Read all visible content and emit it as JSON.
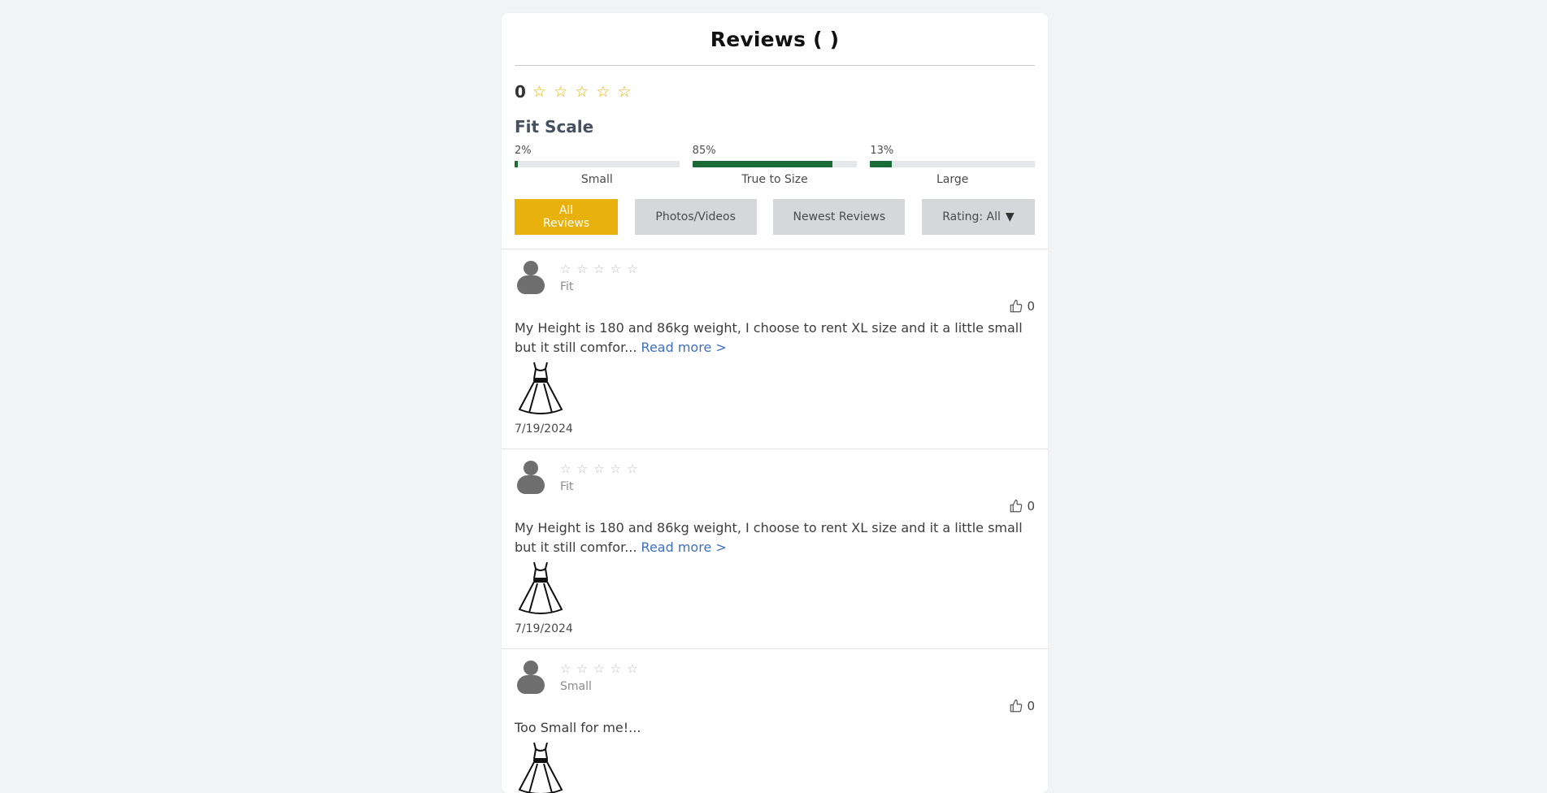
{
  "header": {
    "title": "Reviews ( )"
  },
  "summary": {
    "score": "0",
    "stars": [
      "☆",
      "☆",
      "☆",
      "☆",
      "☆"
    ]
  },
  "fit": {
    "title": "Fit Scale",
    "items": [
      {
        "pct_label": "2%",
        "value": 0.02,
        "label": "Small"
      },
      {
        "pct_label": "85%",
        "value": 0.85,
        "label": "True to Size"
      },
      {
        "pct_label": "13%",
        "value": 0.13,
        "label": "Large"
      }
    ]
  },
  "filters": {
    "all": "All Reviews",
    "photos": "Photos/Videos",
    "newest": "Newest Reviews",
    "rating": "Rating: All",
    "rating_caret": "▼"
  },
  "reviews": [
    {
      "stars": [
        "☆",
        "☆",
        "☆",
        "☆",
        "☆"
      ],
      "fit": "Fit",
      "likes": "0",
      "text": "My Height is 180 and 86kg weight, I choose to rent XL size and it a little small but it still comfor...",
      "read_more": "Read more >",
      "date": "7/19/2024"
    },
    {
      "stars": [
        "☆",
        "☆",
        "☆",
        "☆",
        "☆"
      ],
      "fit": "Fit",
      "likes": "0",
      "text": "My Height is 180 and 86kg weight, I choose to rent XL size and it a little small but it still comfor...",
      "read_more": "Read more >",
      "date": "7/19/2024"
    },
    {
      "stars": [
        "☆",
        "☆",
        "☆",
        "☆",
        "☆"
      ],
      "fit": "Small",
      "likes": "0",
      "text": "Too Small for me!...",
      "read_more": "",
      "date": ""
    }
  ],
  "colors": {
    "accent": "#e8b10e",
    "fit_bar": "#1a6b35",
    "link": "#3f6fbf"
  }
}
